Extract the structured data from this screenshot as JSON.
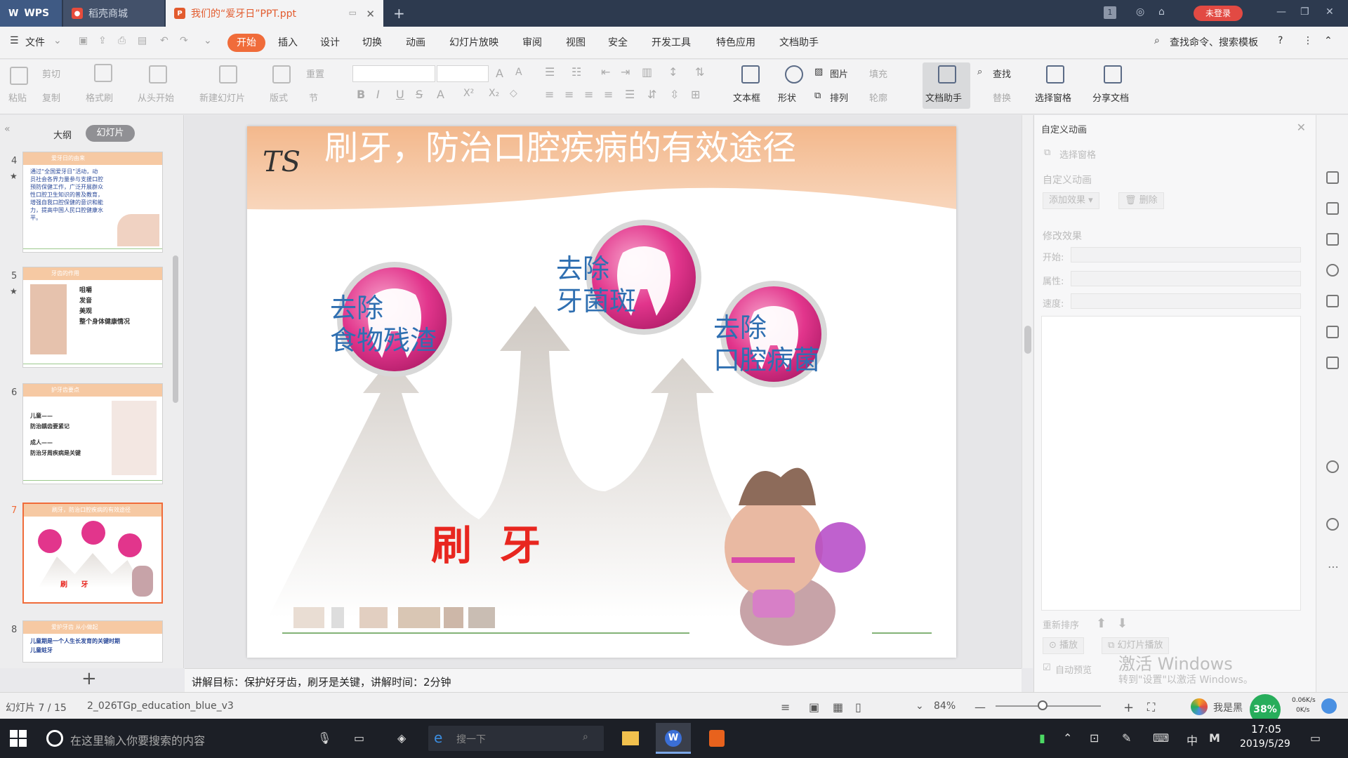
{
  "tabs": {
    "wps": "WPS",
    "store": "稻壳商城",
    "document": "我们的“爱牙日”PPT.ppt",
    "login": "未登录"
  },
  "menu": {
    "file": "文件",
    "items": [
      "开始",
      "插入",
      "设计",
      "切换",
      "动画",
      "幻灯片放映",
      "审阅",
      "视图",
      "安全",
      "开发工具",
      "特色应用",
      "文档助手"
    ],
    "search": "查找命令、搜索模板"
  },
  "ribbon": {
    "paste": "粘贴",
    "cut": "剪切",
    "copy": "复制",
    "format_painter": "格式刷",
    "from_start": "从头开始",
    "new_slide": "新建幻灯片",
    "layout": "版式",
    "reset": "重置",
    "section": "节",
    "textbox": "文本框",
    "shape": "形状",
    "picture": "图片",
    "fill": "填充",
    "arrange": "排列",
    "outline": "轮廓",
    "doc_helper": "文档助手",
    "find": "查找",
    "replace": "替换",
    "select_pane": "选择窗格",
    "share_doc": "分享文档"
  },
  "left_panel": {
    "outline_tab": "大纲",
    "slides_tab": "幻灯片",
    "thumbnails": [
      {
        "num": "4",
        "title": "爱牙日的由来",
        "lines": [
          "通过“全国爱牙日”活动，动",
          "员社会各界力量参与支援口腔",
          "预防保健工作，广泛开展群众",
          "性口腔卫生知识的普及教育，",
          "增强自我口腔保健的意识和能",
          "力，提高中国人民口腔健康水",
          "平。"
        ]
      },
      {
        "num": "5",
        "title": "牙齿的作用",
        "lines": [
          "咀嚼",
          "发音",
          "美观",
          "整个身体健康情况"
        ]
      },
      {
        "num": "6",
        "title": "护牙齿要点",
        "lines": [
          "儿童——",
          "防治龋齿要紧记",
          "成人——",
          "防治牙周疾病是关键"
        ]
      },
      {
        "num": "7",
        "title": "刷牙，防治口腔疾病的有效途径",
        "lines": [
          "刷    牙"
        ]
      },
      {
        "num": "8",
        "title": "爱护牙齿 从小做起",
        "lines": [
          "儿童期是一个人生长发育的关键时期",
          "儿童蛀牙"
        ]
      }
    ]
  },
  "slide": {
    "title": "刷牙，防治口腔疾病的有效途径",
    "label_left": "去除\n食物残渣",
    "label_center": "去除\n牙菌斑",
    "label_right": "去除\n口腔病菌",
    "center_text": "刷牙",
    "logo": "TS"
  },
  "notes": "讲解目标：保护好牙齿，刷牙是关键，讲解时间：2分钟",
  "right_panel": {
    "title": "自定义动画",
    "select_pane": "选择窗格",
    "custom_anim": "自定义动画",
    "add_effect": "添加效果",
    "delete": "删除",
    "modify_effect": "修改效果",
    "start_label": "开始:",
    "property_label": "属性:",
    "speed_label": "速度:",
    "reorder": "重新排序",
    "play": "播放",
    "slideshow": "幻灯片播放",
    "auto_preview": "自动预览",
    "watermark": "激活 Windows",
    "watermark2": "转到\"设置\"以激活 Windows。"
  },
  "status": {
    "slide_count": "幻灯片 7 / 15",
    "theme": "2_026TGp_education_blue_v3",
    "zoom": "84%",
    "net": "38%",
    "net_up": "0.06K/s",
    "net_down": "0K/s",
    "user": "我是黑"
  },
  "taskbar": {
    "search": "在这里输入你要搜索的内容",
    "search2": "搜一下",
    "time": "17:05",
    "date": "2019/5/29",
    "ime": "中"
  },
  "colors": {
    "accent": "#f06c3a",
    "title_band": "#f6c49c",
    "label_blue": "#2f6fb1",
    "brush_red": "#e8261f",
    "circle_pink": "#e2358c"
  }
}
